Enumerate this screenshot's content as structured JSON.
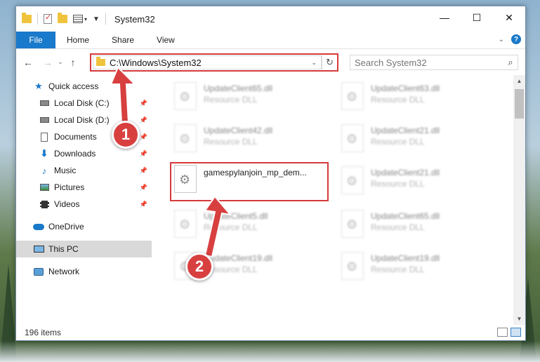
{
  "window": {
    "title": "System32"
  },
  "ribbon": {
    "tabs": [
      "File",
      "Home",
      "Share",
      "View"
    ],
    "help": "?"
  },
  "nav": {
    "back": "←",
    "forward": "→",
    "recent": "⌄",
    "up": "↑",
    "address": "C:\\Windows\\System32",
    "search_placeholder": "Search System32"
  },
  "sidebar": {
    "items": [
      {
        "label": "Quick access"
      },
      {
        "label": "Local Disk (C:)"
      },
      {
        "label": "Local Disk (D:)"
      },
      {
        "label": "Documents"
      },
      {
        "label": "Downloads"
      },
      {
        "label": "Music"
      },
      {
        "label": "Pictures"
      },
      {
        "label": "Videos"
      },
      {
        "label": "OneDrive"
      },
      {
        "label": "This PC"
      },
      {
        "label": "Network"
      }
    ]
  },
  "files": [
    {
      "name": "UpdateClient65.dll",
      "type": "Resource DLL"
    },
    {
      "name": "UpdateClient63.dll",
      "type": "Resource DLL"
    },
    {
      "name": "UpdateClient42.dll",
      "type": "Resource DLL"
    },
    {
      "name": "UpdateClient21.dll",
      "type": "Resource DLL"
    },
    {
      "name": "gamespylanjoin_mp_dem...",
      "type": ""
    },
    {
      "name": "UpdateClient21.dll",
      "type": "Resource DLL"
    },
    {
      "name": "UpdateClient5.dll",
      "type": "Resource DLL"
    },
    {
      "name": "UpdateClient65.dll",
      "type": "Resource DLL"
    },
    {
      "name": "UpdateClient19.dll",
      "type": "Resource DLL"
    },
    {
      "name": "UpdateClient19.dll",
      "type": "Resource DLL"
    }
  ],
  "status": {
    "item_count": "196 items"
  },
  "annotations": {
    "step1": "1",
    "step2": "2",
    "color": "#d84040"
  }
}
